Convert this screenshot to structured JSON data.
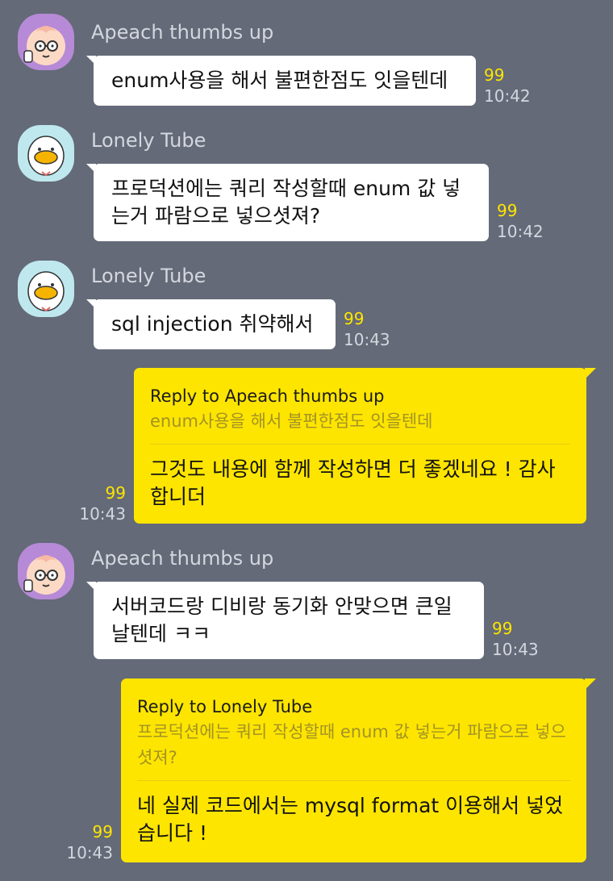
{
  "messages": [
    {
      "sender": "Apeach thumbs up",
      "text": "enum사용을 해서 불편한점도 잇을텐데",
      "count": "99",
      "time": "10:42"
    },
    {
      "sender": "Lonely Tube",
      "text": "프로덕션에는 쿼리 작성할때 enum 값 넣는거 파람으로 넣으셧져?",
      "count": "99",
      "time": "10:42"
    },
    {
      "sender": "Lonely Tube",
      "text": "sql injection 취약해서",
      "count": "99",
      "time": "10:43"
    },
    {
      "reply_label": "Reply to Apeach thumbs up",
      "quoted": "enum사용을 해서 불편한점도 잇을텐데",
      "text": "그것도 내용에 함께 작성하면 더 좋겠네요 ! 감사합니더",
      "count": "99",
      "time": "10:43"
    },
    {
      "sender": "Apeach thumbs up",
      "text": "서버코드랑 디비랑 동기화 안맞으면 큰일 날텐데 ㅋㅋ",
      "count": "99",
      "time": "10:43"
    },
    {
      "reply_label": "Reply to Lonely Tube",
      "quoted": "프로덕션에는 쿼리 작성할때 enum 값 넣는거 파람으로 넣으셧져?",
      "text": "네 실제 코드에서는 mysql format 이용해서 넣었습니다 !",
      "count": "99",
      "time": "10:43"
    }
  ],
  "icons": {
    "apeach": "apeach-avatar-icon",
    "tube": "tube-avatar-icon"
  },
  "colors": {
    "background": "#646a78",
    "my_bubble": "#fee500",
    "their_bubble": "#ffffff",
    "unread_count": "#fee500",
    "meta_text": "#d4d7de"
  }
}
